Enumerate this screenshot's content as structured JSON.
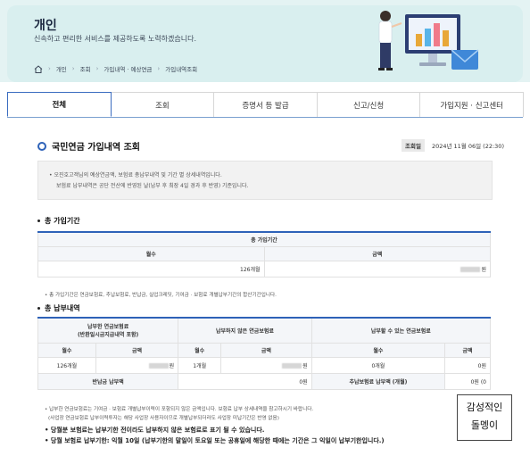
{
  "banner": {
    "title": "개인",
    "subtitle": "신속하고 편리한 서비스를 제공하도록 노력하겠습니다.",
    "breadcrumb": [
      "개인",
      "조회",
      "가입내역 · 예상연금",
      "가입내역조회"
    ]
  },
  "tabs": [
    {
      "label": "전체",
      "active": true
    },
    {
      "label": "조회",
      "active": false
    },
    {
      "label": "증명서 등 발급",
      "active": false
    },
    {
      "label": "신고/신청",
      "active": false
    },
    {
      "label": "가입지원 · 신고센터",
      "active": false
    }
  ],
  "section": {
    "title": "국민연금 가입내역 조회",
    "view_date_label": "조회일",
    "view_date": "2024년 11월 06일 (22:30)"
  },
  "notice": {
    "line1": "오진호고객님의 예상연금액, 보험료 총납부내역 및 기간 별 상세내역입니다.",
    "line2": "보험료 납부내역은 공단 전산에 반영된 날(납부 후 최장 4일 경과 후 반영) 기준입니다."
  },
  "period": {
    "title": "총 가입기간",
    "table_header": "총 가입기간",
    "col_months": "월수",
    "col_amount": "금액",
    "months": "126개월",
    "amount_suffix": "원",
    "footnote": "총 가입기간은 연금보험료, 추납보험료, 반납금, 실업크레딧, 기여금 · 보험료 개별납부기간의 합산기간입니다."
  },
  "payment": {
    "title": "총 납부내역",
    "group1": "납부한 연금보험료\n(반환일시금지급내역 포함)",
    "group1_line1": "납부한 연금보험료",
    "group1_line2": "(반환일시금지급내역 포함)",
    "group2": "납부하지 않은 연금보험료",
    "group3": "납부할 수 있는 연금보험료",
    "col_months": "월수",
    "col_amount": "금액",
    "row": {
      "paid_months": "126개월",
      "paid_amount_suffix": "원",
      "unpaid_months": "1개월",
      "unpaid_amount_suffix": "원",
      "payable_months": "0개월",
      "payable_amount": "0원"
    },
    "refund_label": "반납금 납부액",
    "refund_value": "0원",
    "extra_label": "추납보험료 납부액 (개월)",
    "extra_value": "0원 (0"
  },
  "footnotes": {
    "n1": "납부한 연금보험료는 기여금 · 보험료 개별납부이력이 포함되지 않은 금액입니다. 보험료 납부 상세내역을 참고하시기 바랍니다.",
    "n2": "(사업장 연금보험료 납부이력투자는 해당 사업장 사용자이므로 개별납부되더라도 사업장 미납기간은 반영 없음)",
    "s1": "당월분 보험료는 납부기한 전이라도 납부하지 않은 보험료로 표기 될 수 있습니다.",
    "s2": "당월 보험료 납부기한: 익월 10일 (납부기한의 말일이 토요일 또는 공휴일에 해당한 때에는 기간은 그 익일이 납부기한입니다.)"
  },
  "watermark": {
    "line1": "감성적인",
    "line2": "돌멩이"
  }
}
